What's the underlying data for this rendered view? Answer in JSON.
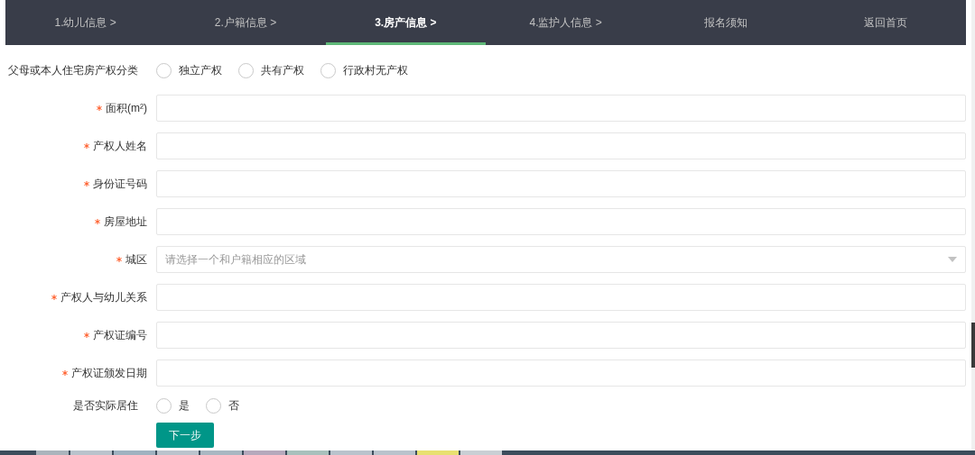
{
  "steps": [
    {
      "label": "1.幼儿信息 >",
      "selected": false
    },
    {
      "label": "2.户籍信息 >",
      "selected": false
    },
    {
      "label": "3.房产信息 >",
      "selected": true
    },
    {
      "label": "4.监护人信息 >",
      "selected": false
    },
    {
      "label": "报名须知",
      "selected": false
    },
    {
      "label": "返回首页",
      "selected": false
    }
  ],
  "ownership": {
    "label": "父母或本人住宅房产权分类",
    "options": [
      {
        "label": "独立产权",
        "selected": false
      },
      {
        "label": "共有产权",
        "selected": false
      },
      {
        "label": "行政村无产权",
        "selected": false
      }
    ]
  },
  "fields": [
    {
      "label": "面积(m²)",
      "required": true,
      "kind": "input"
    },
    {
      "label": "产权人姓名",
      "required": true,
      "kind": "input"
    },
    {
      "label": "身份证号码",
      "required": true,
      "kind": "input"
    },
    {
      "label": "房屋地址",
      "required": true,
      "kind": "input"
    },
    {
      "label": "城区",
      "required": true,
      "kind": "select",
      "placeholder": "请选择一个和户籍相应的区域"
    },
    {
      "label": "产权人与幼儿关系",
      "required": true,
      "kind": "input"
    },
    {
      "label": "产权证编号",
      "required": true,
      "kind": "input"
    },
    {
      "label": "产权证颁发日期",
      "required": true,
      "kind": "input"
    }
  ],
  "residence": {
    "label": "是否实际居住",
    "options": [
      {
        "label": "是",
        "selected": false
      },
      {
        "label": "否",
        "selected": false
      }
    ]
  },
  "next_button": "下一步"
}
